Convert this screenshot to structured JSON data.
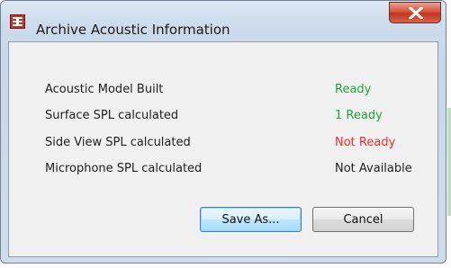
{
  "window": {
    "title": "Archive Acoustic Information"
  },
  "icons": {
    "app": "archive-app-icon",
    "close": "close-icon"
  },
  "colors": {
    "ready": "#21a33a",
    "not_ready": "#ff2a2a",
    "not_available": "#1e1e1e"
  },
  "rows": [
    {
      "label": "Acoustic Model Built",
      "status": "Ready",
      "state": "ready"
    },
    {
      "label": "Surface SPL calculated",
      "status": "1 Ready",
      "state": "ready"
    },
    {
      "label": "Side View SPL calculated",
      "status": "Not Ready",
      "state": "not_ready"
    },
    {
      "label": "Microphone SPL calculated",
      "status": "Not Available",
      "state": "not_available"
    }
  ],
  "buttons": {
    "save_as": "Save As...",
    "cancel": "Cancel"
  }
}
